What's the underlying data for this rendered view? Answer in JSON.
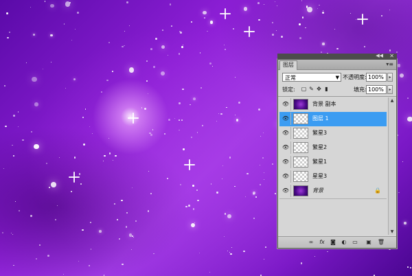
{
  "panel": {
    "tab_label": "图层",
    "blend_mode": "正常",
    "opacity_label": "不透明度:",
    "opacity_value": "100%",
    "lock_label": "锁定:",
    "fill_label": "填充:",
    "fill_value": "100%"
  },
  "layers": [
    {
      "name": "背景 副本",
      "thumb": "dark",
      "selected": false
    },
    {
      "name": "图层 1",
      "thumb": "check",
      "selected": true
    },
    {
      "name": "繁星3",
      "thumb": "check",
      "selected": false
    },
    {
      "name": "繁星2",
      "thumb": "check",
      "selected": false
    },
    {
      "name": "繁星1",
      "thumb": "check",
      "selected": false
    },
    {
      "name": "星星3",
      "thumb": "check",
      "selected": false
    },
    {
      "name": "背景",
      "thumb": "dark",
      "selected": false,
      "locked": true
    }
  ],
  "icons": {
    "eye": "eye-icon",
    "link": "link-layers-icon",
    "fx": "fx",
    "mask": "add-mask-icon",
    "adjust": "adjustment-layer-icon",
    "group": "new-group-icon",
    "new": "new-layer-icon",
    "trash": "delete-layer-icon"
  }
}
